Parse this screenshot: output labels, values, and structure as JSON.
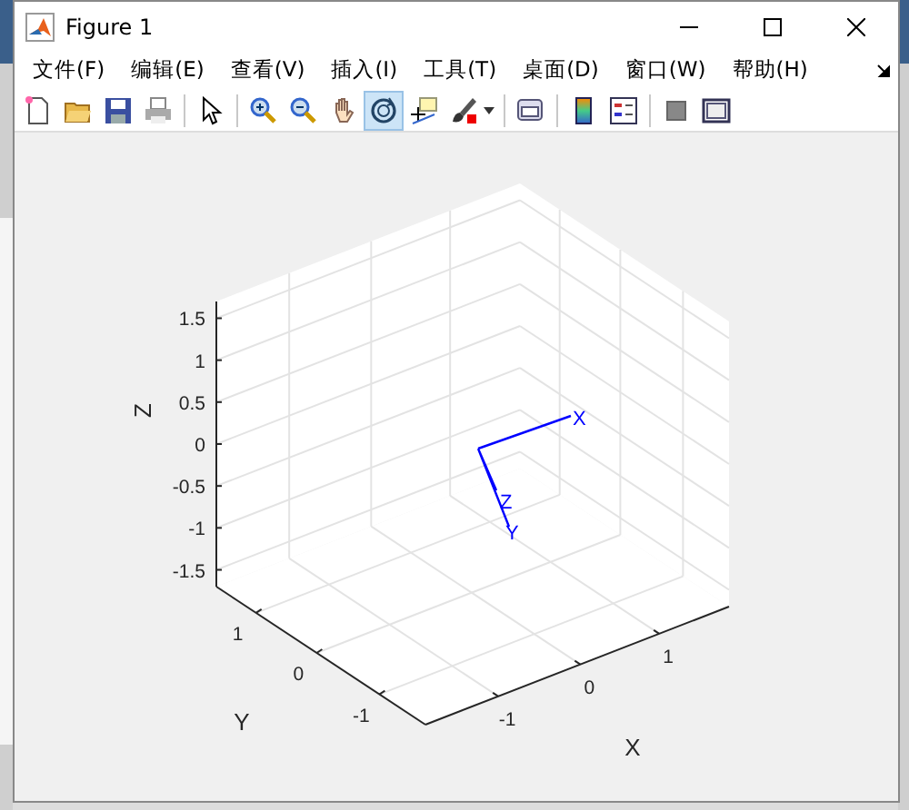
{
  "window": {
    "title": "Figure 1"
  },
  "menu": [
    "文件(F)",
    "编辑(E)",
    "查看(V)",
    "插入(I)",
    "工具(T)",
    "桌面(D)",
    "窗口(W)",
    "帮助(H)"
  ],
  "toolbar": [
    {
      "kind": "new",
      "selected": false
    },
    {
      "kind": "open",
      "selected": false
    },
    {
      "kind": "save",
      "selected": false
    },
    {
      "kind": "print",
      "selected": false
    },
    {
      "kind": "sep"
    },
    {
      "kind": "pointer",
      "selected": false
    },
    {
      "kind": "sep"
    },
    {
      "kind": "zoom-in",
      "selected": false
    },
    {
      "kind": "zoom-out",
      "selected": false
    },
    {
      "kind": "pan",
      "selected": false
    },
    {
      "kind": "rotate",
      "selected": true
    },
    {
      "kind": "data-cursor",
      "selected": false
    },
    {
      "kind": "brush",
      "selected": false
    },
    {
      "kind": "caret"
    },
    {
      "kind": "sep"
    },
    {
      "kind": "link",
      "selected": false
    },
    {
      "kind": "sep"
    },
    {
      "kind": "colorbar",
      "selected": false
    },
    {
      "kind": "legend",
      "selected": false
    },
    {
      "kind": "sep"
    },
    {
      "kind": "hide-tools",
      "selected": false
    },
    {
      "kind": "show-tools",
      "selected": false
    }
  ],
  "axes": {
    "xlabel": "X",
    "ylabel": "Y",
    "zlabel": "Z",
    "xticks": [
      "-1",
      "0",
      "1"
    ],
    "yticks": [
      "1",
      "0",
      "-1"
    ],
    "zticks": [
      "1.5",
      "1",
      "0.5",
      "0",
      "-0.5",
      "-1",
      "-1.5"
    ]
  },
  "frame": {
    "x_label": "X",
    "y_label": "Y",
    "z_label": "Z"
  }
}
